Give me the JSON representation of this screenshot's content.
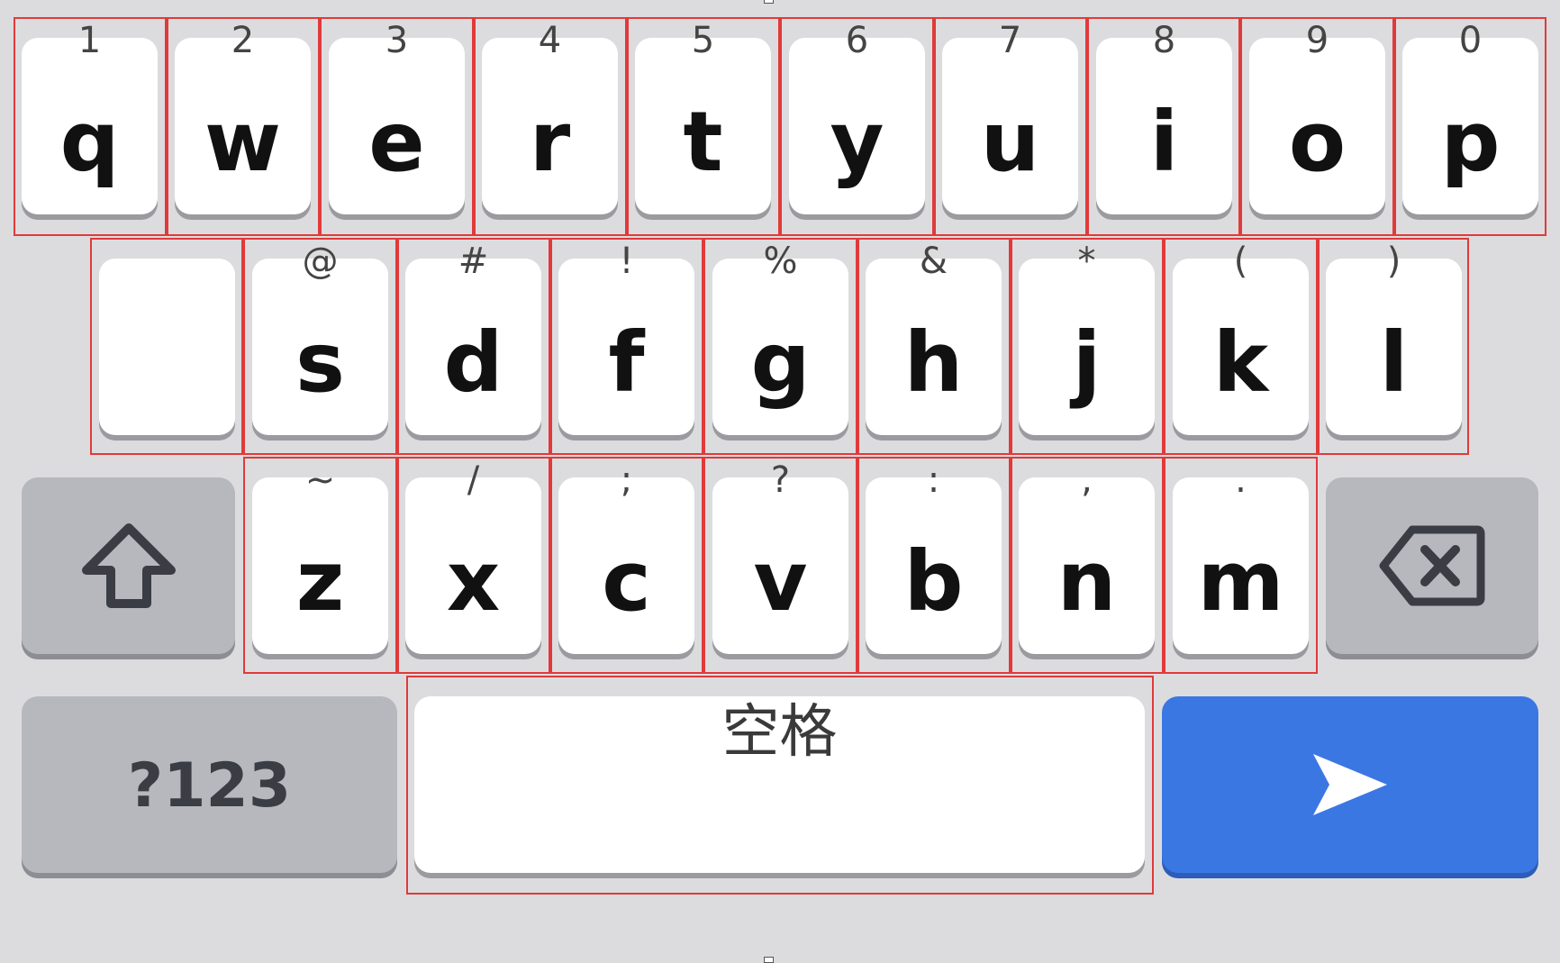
{
  "keyboard": {
    "row1": [
      {
        "letter": "q",
        "hint": "1"
      },
      {
        "letter": "w",
        "hint": "2"
      },
      {
        "letter": "e",
        "hint": "3"
      },
      {
        "letter": "r",
        "hint": "4"
      },
      {
        "letter": "t",
        "hint": "5"
      },
      {
        "letter": "y",
        "hint": "6"
      },
      {
        "letter": "u",
        "hint": "7"
      },
      {
        "letter": "i",
        "hint": "8"
      },
      {
        "letter": "o",
        "hint": "9"
      },
      {
        "letter": "p",
        "hint": "0"
      }
    ],
    "row2": [
      {
        "letter": "",
        "hint": ""
      },
      {
        "letter": "s",
        "hint": "@"
      },
      {
        "letter": "d",
        "hint": "#"
      },
      {
        "letter": "f",
        "hint": "!"
      },
      {
        "letter": "g",
        "hint": "%"
      },
      {
        "letter": "h",
        "hint": "&"
      },
      {
        "letter": "j",
        "hint": "*"
      },
      {
        "letter": "k",
        "hint": "("
      },
      {
        "letter": "l",
        "hint": ")"
      }
    ],
    "row3": [
      {
        "letter": "z",
        "hint": "~"
      },
      {
        "letter": "x",
        "hint": "/"
      },
      {
        "letter": "c",
        "hint": ";"
      },
      {
        "letter": "v",
        "hint": "?"
      },
      {
        "letter": "b",
        "hint": ":"
      },
      {
        "letter": "n",
        "hint": ","
      },
      {
        "letter": "m",
        "hint": "."
      }
    ],
    "shift_icon": "shift-arrow-icon",
    "backspace_icon": "backspace-icon",
    "symbols_label": "?123",
    "space_label": "空格",
    "send_icon": "send-arrow-icon",
    "colors": {
      "background": "#dcdcdf",
      "key": "#ffffff",
      "function_key": "#b6b8be",
      "action_key": "#3b77e3",
      "highlight_outline": "#e03a3a"
    }
  }
}
